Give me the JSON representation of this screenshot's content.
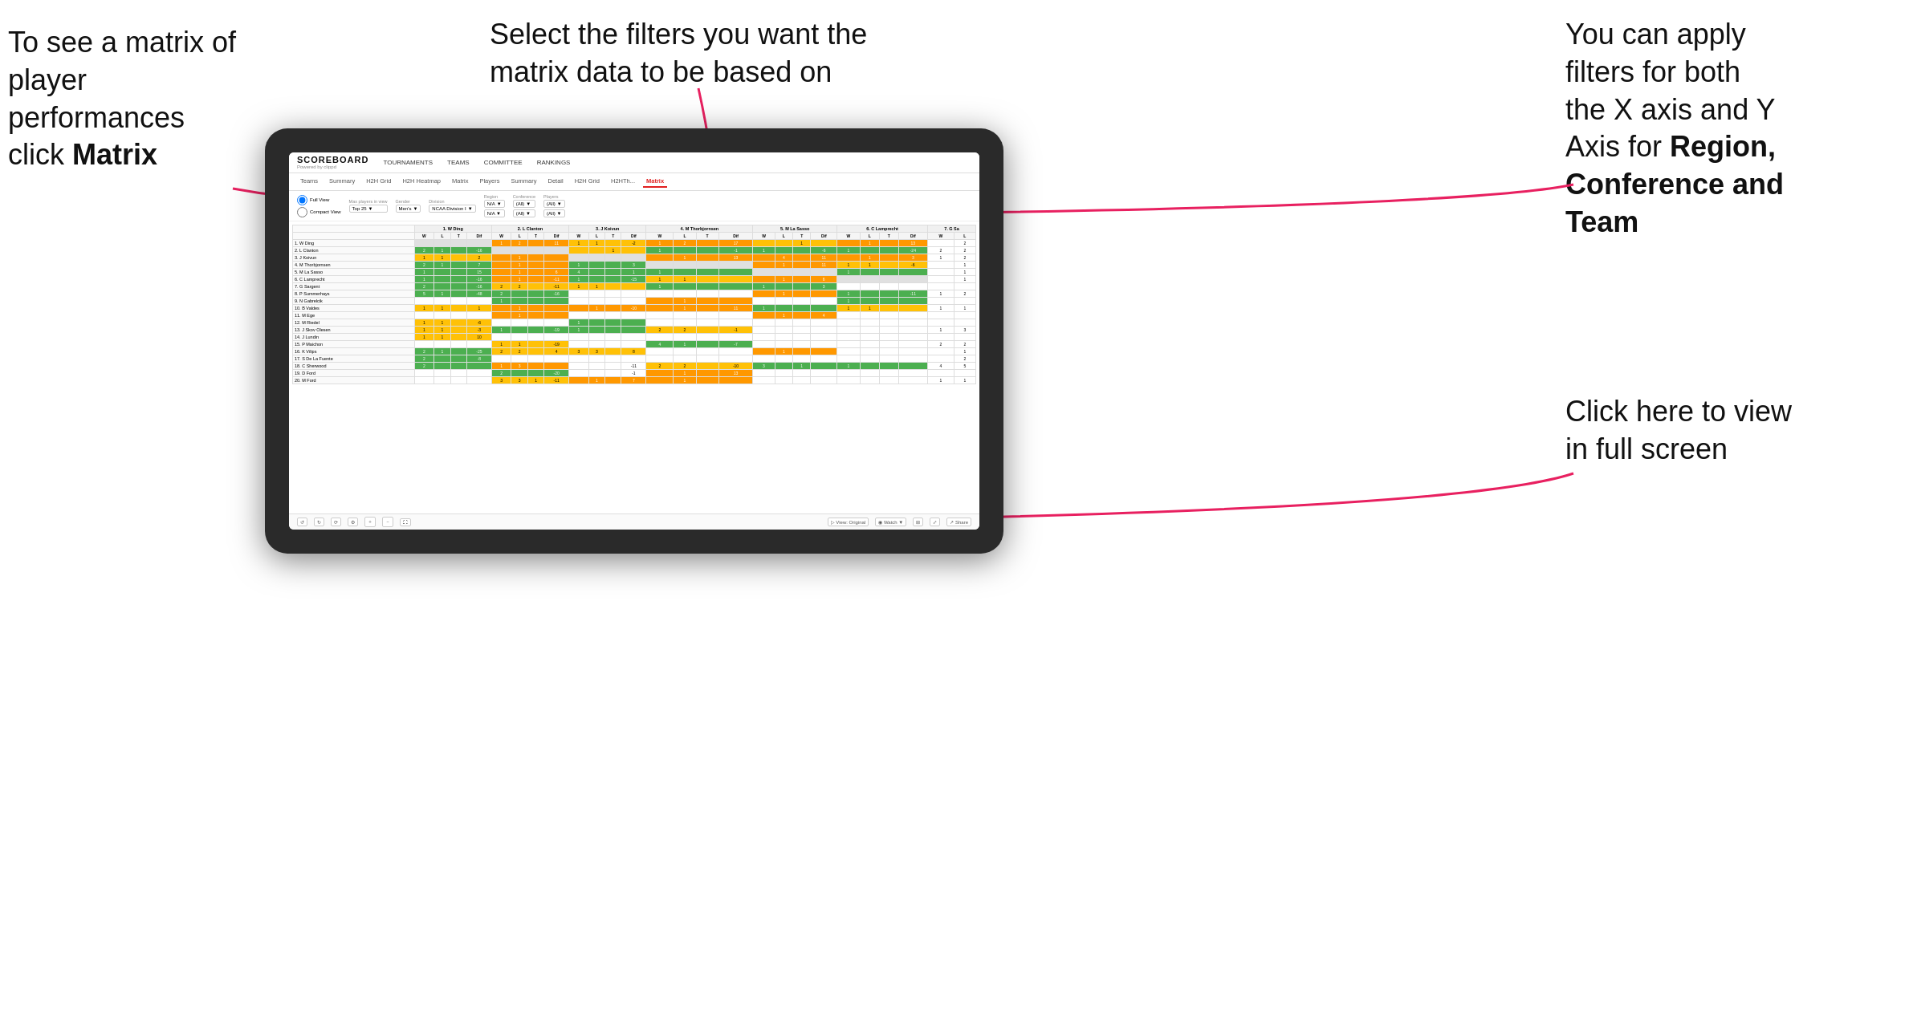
{
  "annotations": {
    "matrix": {
      "line1": "To see a matrix of",
      "line2": "player performances",
      "line3_prefix": "click ",
      "line3_bold": "Matrix"
    },
    "filters": {
      "text": "Select the filters you want the matrix data to be based on"
    },
    "axis": {
      "line1": "You  can apply",
      "line2": "filters for both",
      "line3": "the X axis and Y",
      "line4_prefix": "Axis for ",
      "line4_bold": "Region,",
      "line5_bold": "Conference and",
      "line6_bold": "Team"
    },
    "fullscreen": {
      "line1": "Click here to view",
      "line2": "in full screen"
    }
  },
  "scoreboard": {
    "logo_title": "SCOREBOARD",
    "logo_sub": "Powered by clippd",
    "nav": [
      "TOURNAMENTS",
      "TEAMS",
      "COMMITTEE",
      "RANKINGS"
    ],
    "sub_tabs": [
      "Teams",
      "Summary",
      "H2H Grid",
      "H2H Heatmap",
      "Matrix",
      "Players",
      "Summary",
      "Detail",
      "H2H Grid",
      "H2HTh...",
      "Matrix"
    ],
    "active_tab": "Matrix"
  },
  "filters": {
    "view_options": [
      "Full View",
      "Compact View"
    ],
    "max_players_label": "Max players in view",
    "max_players_value": "Top 25",
    "gender_label": "Gender",
    "gender_value": "Men's",
    "division_label": "Division",
    "division_value": "NCAA Division I",
    "region_label": "Region",
    "region_value": "N/A",
    "conference_label": "Conference",
    "conference_value": "(All)",
    "players_label": "Players",
    "players_value": "(All)"
  },
  "matrix": {
    "col_headers": [
      "1. W Ding",
      "2. L Clanton",
      "3. J Koivun",
      "4. M Thorbjornsen",
      "5. M La Sasso",
      "6. C Lamprecht",
      "7. G Sa"
    ],
    "sub_headers": [
      "W",
      "L",
      "T",
      "Dif"
    ],
    "rows": [
      {
        "label": "1. W Ding",
        "cells": [
          [
            0,
            0,
            0,
            0
          ],
          [
            1,
            2,
            0,
            11
          ],
          [
            1,
            1,
            0,
            -2
          ],
          [
            1,
            2,
            0,
            17
          ],
          [
            0,
            0,
            1,
            0
          ],
          [
            0,
            1,
            0,
            13
          ],
          [
            0,
            2
          ]
        ]
      },
      {
        "label": "2. L Clanton",
        "cells": [
          [
            2,
            1,
            0,
            -16
          ],
          [
            0,
            0,
            0,
            0
          ],
          [
            0,
            0,
            1,
            0
          ],
          [
            1,
            0,
            0,
            -1
          ],
          [
            1,
            0,
            0,
            -6
          ],
          [
            1,
            0,
            0,
            -24
          ],
          [
            2,
            2
          ]
        ]
      },
      {
        "label": "3. J Koivun",
        "cells": [
          [
            1,
            1,
            0,
            2
          ],
          [
            0,
            1,
            0,
            0
          ],
          [
            0,
            0,
            0,
            0
          ],
          [
            0,
            1,
            0,
            13
          ],
          [
            0,
            4,
            0,
            11
          ],
          [
            0,
            1,
            0,
            3
          ],
          [
            1,
            2
          ]
        ]
      },
      {
        "label": "4. M Thorbjornsen",
        "cells": [
          [
            2,
            1,
            0,
            7
          ],
          [
            0,
            1,
            0,
            0
          ],
          [
            1,
            0,
            0,
            3
          ],
          [
            0,
            0,
            0,
            0
          ],
          [
            0,
            1,
            0,
            11
          ],
          [
            1,
            1,
            0,
            -6
          ],
          [
            0,
            1
          ]
        ]
      },
      {
        "label": "5. M La Sasso",
        "cells": [
          [
            1,
            0,
            0,
            15
          ],
          [
            0,
            1,
            0,
            6
          ],
          [
            4,
            0,
            0,
            1
          ],
          [
            1,
            0,
            0,
            0
          ],
          [
            0,
            0,
            0,
            0
          ],
          [
            1,
            0,
            0,
            0
          ],
          [
            0,
            1
          ]
        ]
      },
      {
        "label": "6. C Lamprecht",
        "cells": [
          [
            1,
            0,
            0,
            -16
          ],
          [
            0,
            1,
            0,
            -11
          ],
          [
            1,
            0,
            0,
            -15
          ],
          [
            1,
            1,
            0,
            0
          ],
          [
            0,
            1,
            0,
            6
          ],
          [
            0,
            0,
            0,
            0
          ],
          [
            0,
            1
          ]
        ]
      },
      {
        "label": "7. G Sargent",
        "cells": [
          [
            2,
            0,
            0,
            -16
          ],
          [
            2,
            2,
            0,
            -11
          ],
          [
            1,
            1,
            0,
            0
          ],
          [
            1,
            0,
            0,
            0
          ],
          [
            1,
            0,
            0,
            3
          ],
          [
            0,
            0,
            0,
            0
          ],
          [
            0,
            0
          ]
        ]
      },
      {
        "label": "8. P Summerhays",
        "cells": [
          [
            5,
            1,
            0,
            -48
          ],
          [
            2,
            0,
            0,
            -16
          ],
          [
            0,
            0,
            0,
            0
          ],
          [
            0,
            0,
            0,
            0
          ],
          [
            0,
            1,
            0,
            0
          ],
          [
            1,
            0,
            0,
            -11
          ],
          [
            1,
            2
          ]
        ]
      },
      {
        "label": "9. N Gabrelcik",
        "cells": [
          [
            0,
            0,
            0,
            0
          ],
          [
            1,
            0,
            0,
            0
          ],
          [
            0,
            0,
            0,
            0
          ],
          [
            0,
            1,
            0,
            0
          ],
          [
            0,
            0,
            0,
            0
          ],
          [
            1,
            0,
            0,
            0
          ],
          [
            0,
            0
          ]
        ]
      },
      {
        "label": "10. B Valdes",
        "cells": [
          [
            1,
            1,
            0,
            1
          ],
          [
            0,
            1,
            0,
            0
          ],
          [
            0,
            1,
            0,
            -10
          ],
          [
            0,
            1,
            0,
            11
          ],
          [
            1,
            0,
            0,
            0
          ],
          [
            1,
            1,
            0,
            0
          ],
          [
            1,
            1
          ]
        ]
      },
      {
        "label": "11. M Ege",
        "cells": [
          [
            0,
            0,
            0,
            0
          ],
          [
            0,
            1,
            0,
            0
          ],
          [
            0,
            0,
            0,
            0
          ],
          [
            0,
            0,
            0,
            0
          ],
          [
            0,
            1,
            0,
            4
          ],
          [
            0,
            0,
            0,
            0
          ],
          [
            0,
            0
          ]
        ]
      },
      {
        "label": "12. M Riedel",
        "cells": [
          [
            1,
            1,
            0,
            -6
          ],
          [
            0,
            0,
            0,
            0
          ],
          [
            1,
            0,
            0,
            0
          ],
          [
            0,
            0,
            0,
            0
          ],
          [
            0,
            0,
            0,
            0
          ],
          [
            0,
            0,
            0,
            0
          ],
          [
            0,
            0
          ]
        ]
      },
      {
        "label": "13. J Skov Olesen",
        "cells": [
          [
            1,
            1,
            0,
            -3
          ],
          [
            1,
            0,
            0,
            -19
          ],
          [
            1,
            0,
            0,
            0
          ],
          [
            2,
            2,
            0,
            -1
          ],
          [
            0,
            0,
            0,
            0
          ],
          [
            0,
            0,
            0,
            0
          ],
          [
            1,
            3
          ]
        ]
      },
      {
        "label": "14. J Lundin",
        "cells": [
          [
            1,
            1,
            0,
            10
          ],
          [
            0,
            0,
            0,
            0
          ],
          [
            0,
            0,
            0,
            0
          ],
          [
            0,
            0,
            0,
            0
          ],
          [
            0,
            0,
            0,
            0
          ],
          [
            0,
            0,
            0,
            0
          ],
          [
            0,
            0
          ]
        ]
      },
      {
        "label": "15. P Maichon",
        "cells": [
          [
            0,
            0,
            0,
            0
          ],
          [
            1,
            1,
            0,
            -19
          ],
          [
            0,
            0,
            0,
            0
          ],
          [
            4,
            1,
            0,
            -7
          ],
          [
            0,
            0,
            0,
            0
          ],
          [
            0,
            0,
            0,
            0
          ],
          [
            2,
            2
          ]
        ]
      },
      {
        "label": "16. K Vilips",
        "cells": [
          [
            2,
            1,
            0,
            -25
          ],
          [
            2,
            2,
            0,
            4
          ],
          [
            3,
            3,
            0,
            8
          ],
          [
            0,
            0,
            0,
            0
          ],
          [
            0,
            1,
            0,
            0
          ],
          [
            0,
            0,
            0,
            0
          ],
          [
            0,
            1
          ]
        ]
      },
      {
        "label": "17. S De La Fuente",
        "cells": [
          [
            2,
            0,
            0,
            -8
          ],
          [
            0,
            0,
            0,
            0
          ],
          [
            0,
            0,
            0,
            0
          ],
          [
            0,
            0,
            0,
            0
          ],
          [
            0,
            0,
            0,
            0
          ],
          [
            0,
            0,
            0,
            0
          ],
          [
            0,
            2
          ]
        ]
      },
      {
        "label": "18. C Sherwood",
        "cells": [
          [
            2,
            0,
            0,
            0
          ],
          [
            1,
            3,
            0,
            0
          ],
          [
            0,
            0,
            0,
            -11
          ],
          [
            2,
            2,
            0,
            -10
          ],
          [
            3,
            0,
            1,
            0
          ],
          [
            1,
            0,
            0,
            0
          ],
          [
            4,
            5
          ]
        ]
      },
      {
        "label": "19. D Ford",
        "cells": [
          [
            0,
            0,
            0,
            0
          ],
          [
            2,
            0,
            0,
            -20
          ],
          [
            0,
            0,
            0,
            -1
          ],
          [
            0,
            1,
            0,
            13
          ],
          [
            0,
            0,
            0,
            0
          ],
          [
            0,
            0,
            0,
            0
          ],
          [
            0,
            0
          ]
        ]
      },
      {
        "label": "20. M Ford",
        "cells": [
          [
            0,
            0,
            0,
            0
          ],
          [
            3,
            3,
            1,
            -11
          ],
          [
            0,
            1,
            0,
            7
          ],
          [
            0,
            1,
            0,
            0
          ],
          [
            0,
            0,
            0,
            0
          ],
          [
            0,
            0,
            0,
            0
          ],
          [
            1,
            1
          ]
        ]
      }
    ]
  },
  "toolbar": {
    "view_label": "View: Original",
    "watch_label": "Watch",
    "share_label": "Share"
  }
}
